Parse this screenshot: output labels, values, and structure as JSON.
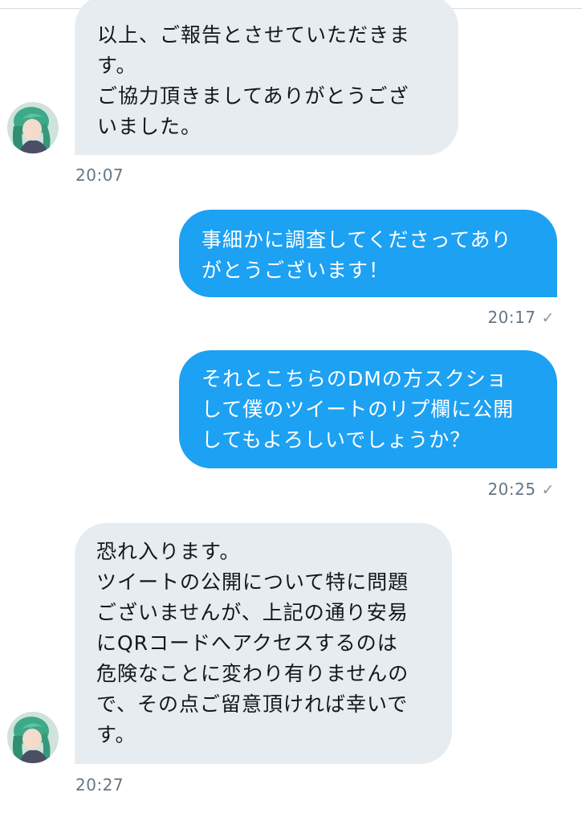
{
  "messages": [
    {
      "direction": "incoming",
      "text": "以上、ご報告とさせていただきま\nす。\nご協力頂きましてありがとうござ\nいました。",
      "time": "20:07"
    },
    {
      "direction": "outgoing",
      "text": "事細かに調査してくださってあり\nがとうございます！",
      "time": "20:17",
      "status_icon": "check-icon"
    },
    {
      "direction": "outgoing",
      "text": "それとこちらのDMの方スクショ\nして僕のツイートのリプ欄に公開\nしてもよろしいでしょうか？",
      "time": "20:25",
      "status_icon": "check-icon"
    },
    {
      "direction": "incoming",
      "text": "恐れ入ります。\nツイートの公開について特に問題\nございませんが、上記の通り安易\nにQRコードへアクセスするのは\n危険なことに変わり有りませんの\nで、その点ご留意頂ければ幸いで\nす。",
      "time": "20:27"
    }
  ],
  "colors": {
    "incoming_bubble": "#e6ecf0",
    "outgoing_bubble": "#1da1f2",
    "timestamp": "#657786"
  }
}
